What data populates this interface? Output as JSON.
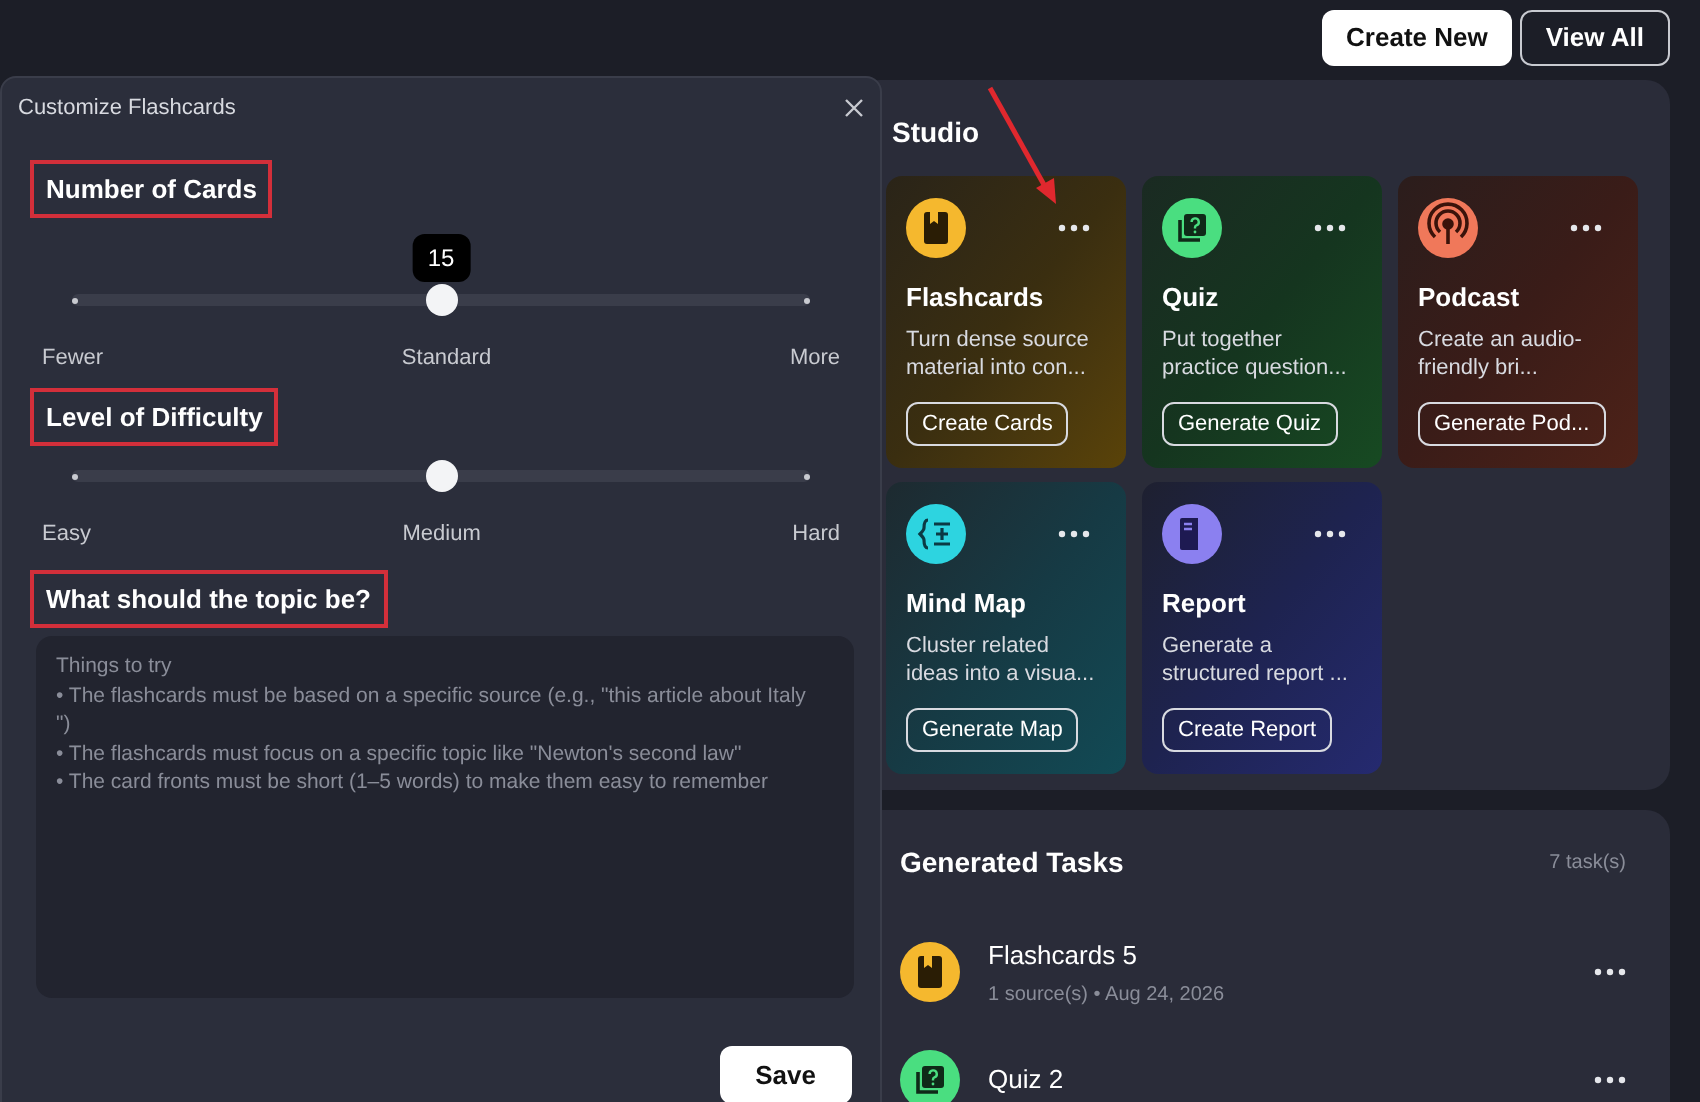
{
  "header_buttons": [
    {
      "label": "Create New",
      "kind": "primary"
    },
    {
      "label": "View All",
      "kind": "outline"
    }
  ],
  "studio": {
    "title": "Studio",
    "cards": [
      {
        "kind": "flashcards",
        "title": "Flashcards",
        "description": "Turn dense source material into con...",
        "button": "Create Cards",
        "color": "#f5b82e"
      },
      {
        "kind": "quiz",
        "title": "Quiz",
        "description": "Put together practice question...",
        "button": "Generate Quiz",
        "color": "#4ade80"
      },
      {
        "kind": "podcast",
        "title": "Podcast",
        "description": "Create an audio-friendly bri...",
        "button": "Generate Pod...",
        "color": "#f0785a"
      },
      {
        "kind": "mindmap",
        "title": "Mind Map",
        "description": "Cluster related ideas into a visua...",
        "button": "Generate Map",
        "color": "#2dd4e0"
      },
      {
        "kind": "report",
        "title": "Report",
        "description": "Generate a structured report ...",
        "button": "Create Report",
        "color": "#8b80f0"
      }
    ]
  },
  "generated_tasks": {
    "title": "Generated Tasks",
    "count": "7 task(s)",
    "items": [
      {
        "kind": "flashcards",
        "title": "Flashcards 5",
        "meta": "1 source(s) • Aug 24, 2026",
        "color": "#f5b82e"
      },
      {
        "kind": "quiz",
        "title": "Quiz 2",
        "color": "#4ade80"
      }
    ]
  },
  "dialog": {
    "title": "Customize Flashcards",
    "sections": [
      {
        "kind": "slider",
        "heading": "Number of Cards",
        "level": 0.5,
        "tooltip": "15",
        "labels": [
          "Fewer",
          "Standard",
          "More"
        ]
      },
      {
        "kind": "slider",
        "heading": "Level of Difficulty",
        "level": 0.5,
        "labels": [
          "Easy",
          "Medium",
          "Hard"
        ]
      },
      {
        "kind": "text",
        "heading": "What should the topic be?",
        "placeholder": "Things to try\n• The flashcards must be based on a specific source (e.g., \"this article about Italy\n\")\n• The flashcards must focus on a specific topic like \"Newton's second law\"\n• The card fronts must be short (1–5 words) to make them easy to remember"
      }
    ],
    "save_button": "Save"
  }
}
